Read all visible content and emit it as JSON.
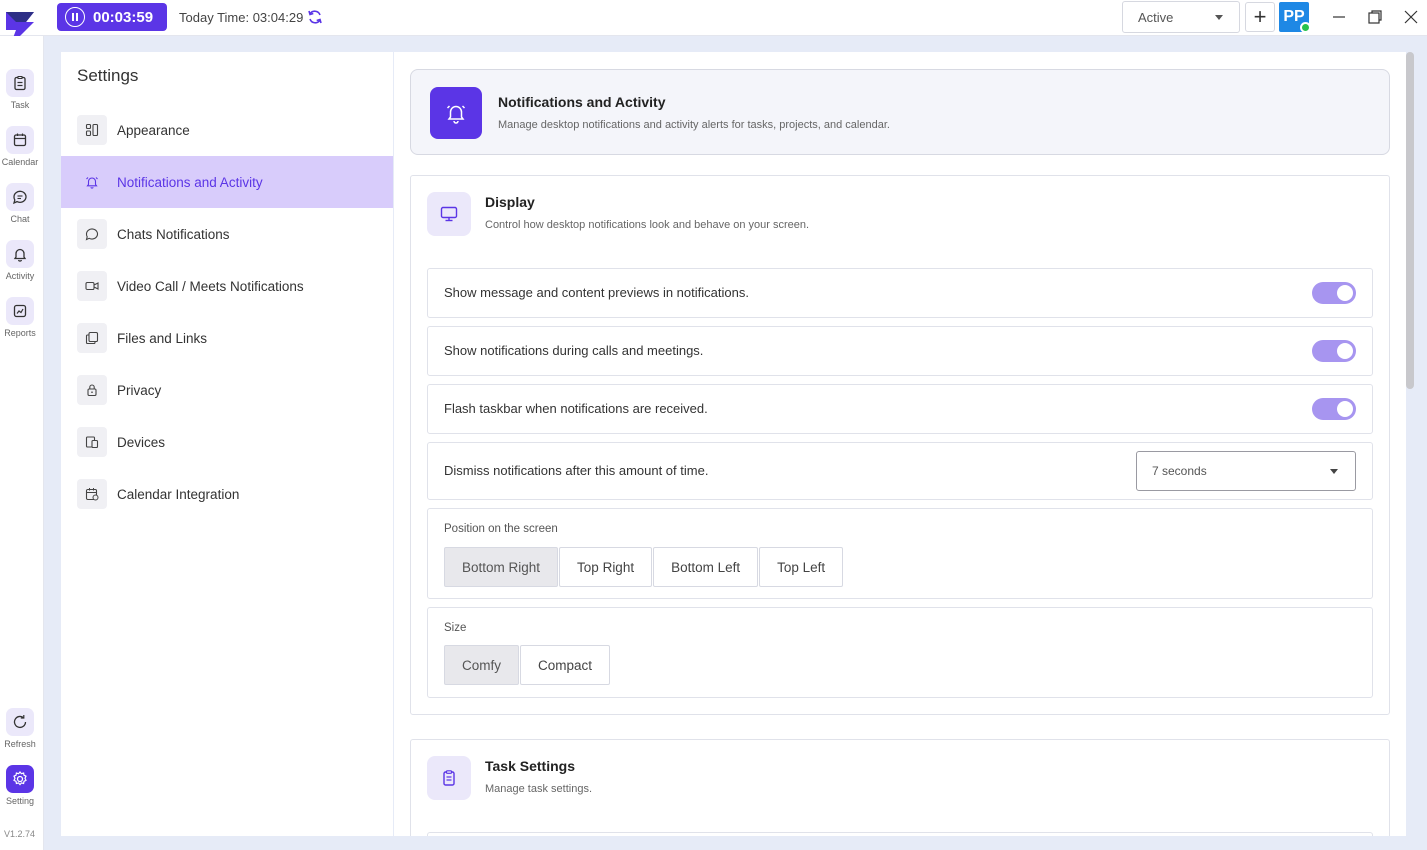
{
  "titlebar": {
    "timer": "00:03:59",
    "today_time": "Today Time: 03:04:29",
    "status": "Active",
    "avatar_initials": "PP"
  },
  "rail": {
    "items": [
      {
        "label": "Task",
        "icon": "task-icon"
      },
      {
        "label": "Calendar",
        "icon": "calendar-icon"
      },
      {
        "label": "Chat",
        "icon": "chat-icon"
      },
      {
        "label": "Activity",
        "icon": "bell-icon"
      },
      {
        "label": "Reports",
        "icon": "reports-icon"
      }
    ],
    "refresh_label": "Refresh",
    "setting_label": "Setting",
    "version": "V1.2.74"
  },
  "settings_nav": {
    "title": "Settings",
    "items": [
      {
        "label": "Appearance",
        "icon": "appearance-icon"
      },
      {
        "label": "Notifications and Activity",
        "icon": "bell-icon",
        "active": true
      },
      {
        "label": "Chats Notifications",
        "icon": "chat-bubble-icon"
      },
      {
        "label": "Video Call / Meets Notifications",
        "icon": "video-icon"
      },
      {
        "label": "Files and Links",
        "icon": "files-icon"
      },
      {
        "label": "Privacy",
        "icon": "lock-icon"
      },
      {
        "label": "Devices",
        "icon": "devices-icon"
      },
      {
        "label": "Calendar Integration",
        "icon": "calendar-sync-icon"
      }
    ]
  },
  "header": {
    "title": "Notifications and Activity",
    "subtitle": "Manage desktop notifications and activity alerts for tasks, projects, and calendar."
  },
  "display": {
    "title": "Display",
    "subtitle": "Control how desktop notifications look and behave on your screen.",
    "toggles": [
      {
        "label": "Show message and content previews in notifications.",
        "on": true
      },
      {
        "label": "Show notifications during calls and meetings.",
        "on": true
      },
      {
        "label": "Flash taskbar when notifications are received.",
        "on": true
      }
    ],
    "dismiss_label": "Dismiss notifications after this amount of time.",
    "dismiss_value": "7 seconds",
    "position_label": "Position on the screen",
    "positions": [
      "Bottom Right",
      "Top Right",
      "Bottom Left",
      "Top Left"
    ],
    "position_selected": "Bottom Right",
    "size_label": "Size",
    "sizes": [
      "Comfy",
      "Compact"
    ],
    "size_selected": "Comfy"
  },
  "task_settings": {
    "title": "Task Settings",
    "subtitle": "Manage task settings."
  },
  "colors": {
    "accent": "#5b35e6",
    "active_nav_bg": "#d8ccfb",
    "toggle_on": "#a795f0",
    "online": "#27c24c"
  }
}
